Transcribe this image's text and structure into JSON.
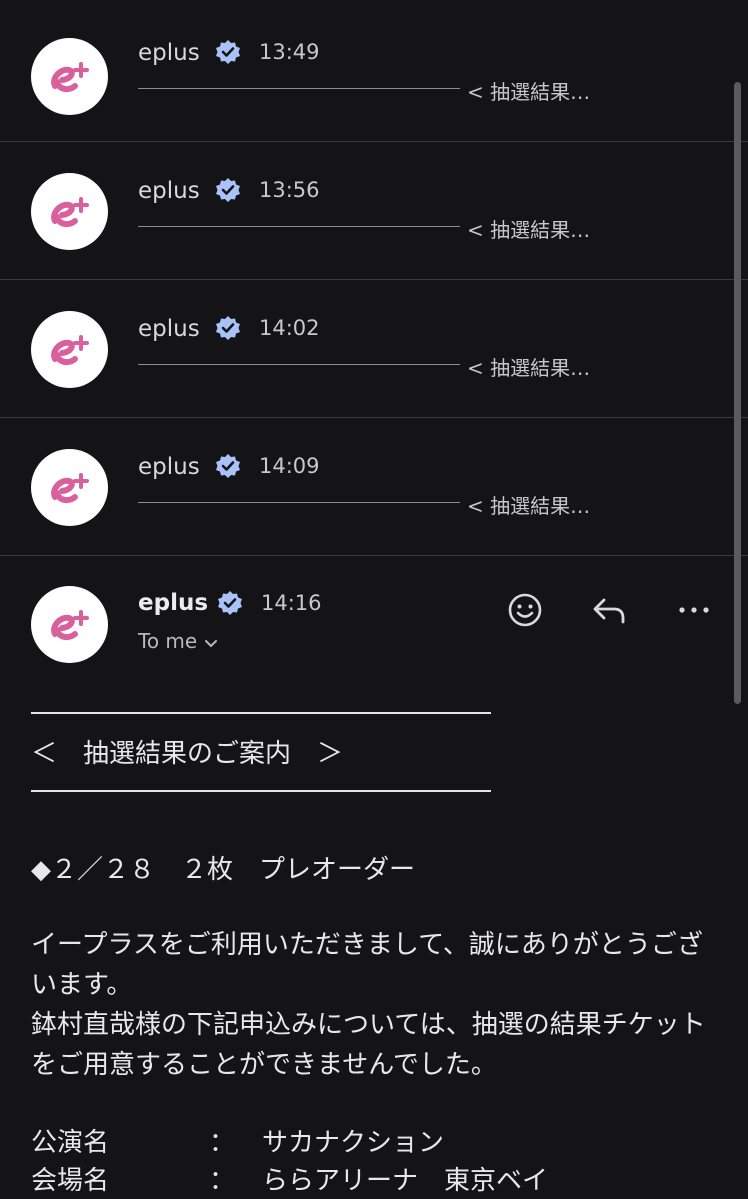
{
  "colors": {
    "background": "#141316",
    "avatar_accent": "#d9609d",
    "verified_badge": "#a9c2f7"
  },
  "threads": [
    {
      "sender": "eplus",
      "time": "13:49",
      "snippet": "< 抽選結果…"
    },
    {
      "sender": "eplus",
      "time": "13:56",
      "snippet": "< 抽選結果…"
    },
    {
      "sender": "eplus",
      "time": "14:02",
      "snippet": "< 抽選結果…"
    },
    {
      "sender": "eplus",
      "time": "14:09",
      "snippet": "< 抽選結果…"
    }
  ],
  "open_message": {
    "sender": "eplus",
    "time": "14:16",
    "recipient": "To me",
    "actions": [
      "emoji-icon",
      "reply-icon",
      "more-icon"
    ]
  },
  "body": {
    "heading": "＜　抽選結果のご案内　＞",
    "order_line": "◆２／２８　２枚　プレオーダー",
    "para1": "イープラスをご利用いただきまして、誠にありがとうございます。",
    "para2": "鉢村直哉様の下記申込みについては、抽選の結果チケットをご用意することができませんでした。",
    "info": [
      {
        "label": "公演名",
        "colon": "：",
        "value": "サカナクション"
      },
      {
        "label": "会場名",
        "colon": "：",
        "value": "ららアリーナ　東京ベイ"
      }
    ]
  }
}
